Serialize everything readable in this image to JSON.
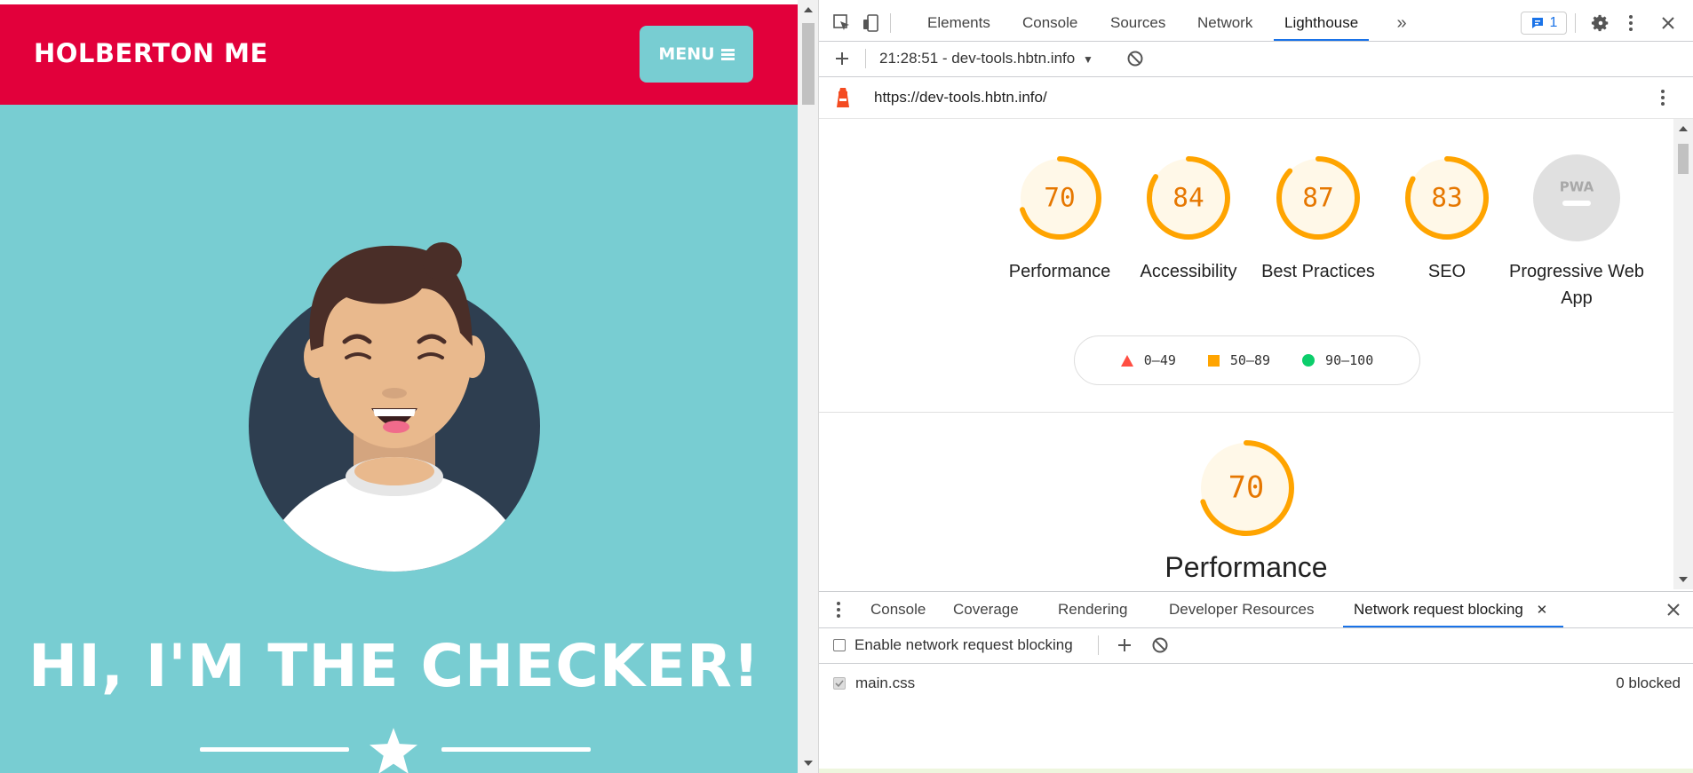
{
  "site": {
    "brand": "HOLBERTON ME",
    "menu_label": "MENU",
    "hero_text": "HI, I'M THE CHECKER!",
    "colors": {
      "header": "#e2003b",
      "background": "#78cdd2",
      "avatar_bg": "#2e3e50"
    }
  },
  "devtools": {
    "tabs": [
      "Elements",
      "Console",
      "Sources",
      "Network",
      "Lighthouse"
    ],
    "active_tab": "Lighthouse",
    "more_tabs_icon": "double-chevron-icon",
    "issues_count": "1",
    "report_selector": "21:28:51 - dev-tools.hbtn.info",
    "url": "https://dev-tools.hbtn.info/",
    "scores": [
      {
        "value": "70",
        "label": "Performance",
        "score": 70,
        "color": "#ffa400"
      },
      {
        "value": "84",
        "label": "Accessibility",
        "score": 84,
        "color": "#ffa400"
      },
      {
        "value": "87",
        "label": "Best Practices",
        "score": 87,
        "color": "#ffa400"
      },
      {
        "value": "83",
        "label": "SEO",
        "score": 83,
        "color": "#ffa400"
      },
      {
        "value": "PWA",
        "label": "Progressive Web App",
        "score": null,
        "color": "#cccccc"
      }
    ],
    "legend": [
      {
        "range": "0–49",
        "shape": "triangle",
        "color": "#ff4e42"
      },
      {
        "range": "50–89",
        "shape": "square",
        "color": "#ffa400"
      },
      {
        "range": "90–100",
        "shape": "circle",
        "color": "#0cce6b"
      }
    ],
    "performance_section": {
      "value": "70",
      "score": 70,
      "title": "Performance"
    },
    "drawer": {
      "tabs": [
        "Console",
        "Coverage",
        "Rendering",
        "Developer Resources",
        "Network request blocking"
      ],
      "active_tab": "Network request blocking",
      "enable_label": "Enable network request blocking",
      "enable_checked": false,
      "patterns": [
        {
          "pattern": "main.css",
          "checked": true,
          "status": "0 blocked"
        }
      ]
    }
  }
}
